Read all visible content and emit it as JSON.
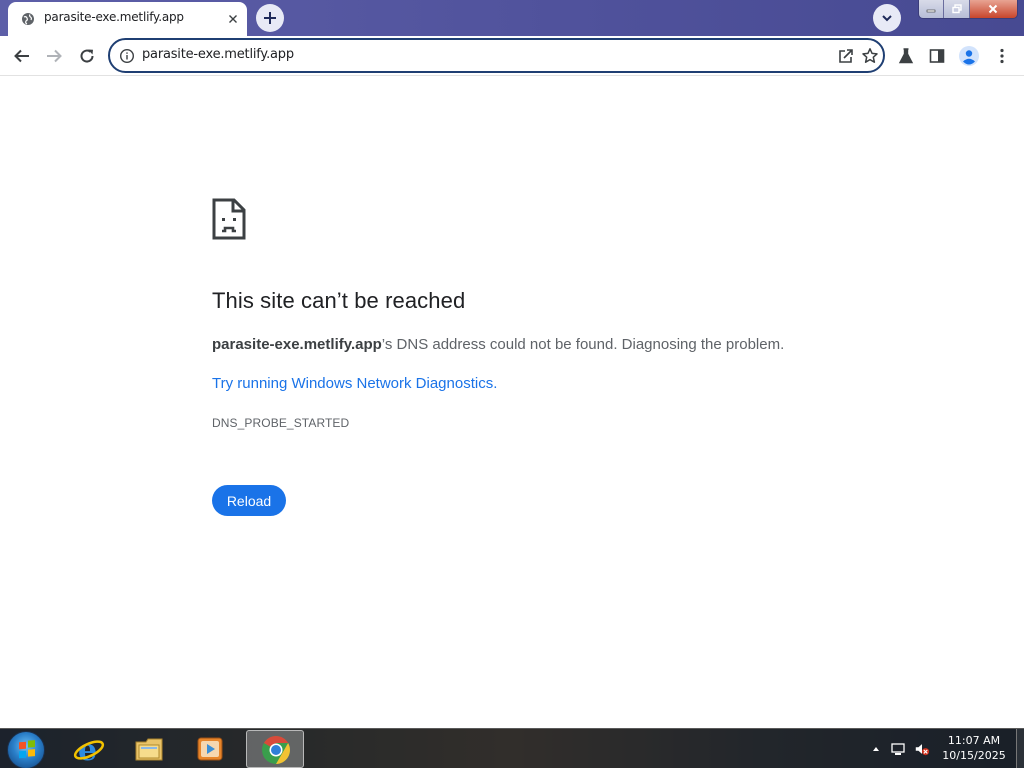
{
  "browser": {
    "tab": {
      "title": "parasite-exe.metlify.app",
      "favicon": "globe-icon"
    },
    "omnibox": {
      "url": "parasite-exe.metlify.app"
    }
  },
  "error_page": {
    "title": "This site can’t be reached",
    "host": "parasite-exe.metlify.app",
    "description_suffix": "’s DNS address could not be found. Diagnosing the problem.",
    "link": "Try running Windows Network Diagnostics.",
    "error_code": "DNS_PROBE_STARTED",
    "reload_label": "Reload"
  },
  "taskbar": {
    "items": [
      "start-orb-icon",
      "internet-explorer-icon",
      "file-explorer-icon",
      "media-player-icon",
      "chrome-icon"
    ],
    "clock": {
      "time": "11:07 AM",
      "date": "10/15/2025"
    }
  },
  "colors": {
    "accent": "#1a73e8",
    "title_text": "#202124",
    "body_text": "#5f6368",
    "omnibox_border": "#1f3f73",
    "titlebar": "#50529c"
  }
}
